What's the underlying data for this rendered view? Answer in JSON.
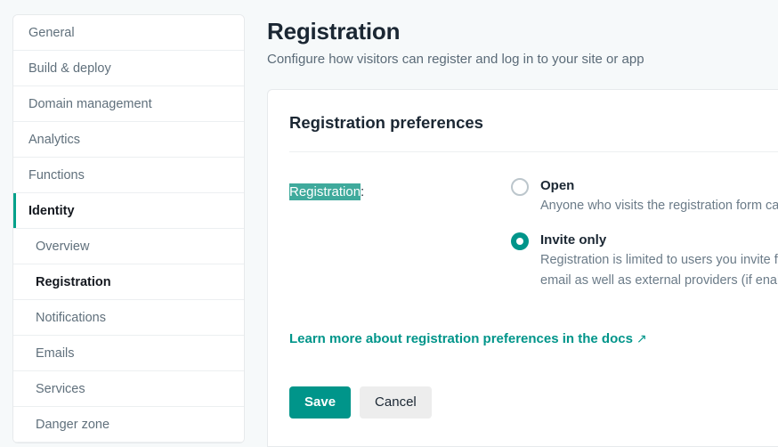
{
  "sidebar": {
    "items": [
      {
        "label": "General",
        "level": "top",
        "active": false
      },
      {
        "label": "Build & deploy",
        "level": "top",
        "active": false
      },
      {
        "label": "Domain management",
        "level": "top",
        "active": false
      },
      {
        "label": "Analytics",
        "level": "top",
        "active": false
      },
      {
        "label": "Functions",
        "level": "top",
        "active": false
      },
      {
        "label": "Identity",
        "level": "top",
        "active": true
      },
      {
        "label": "Overview",
        "level": "sub",
        "active": false
      },
      {
        "label": "Registration",
        "level": "sub",
        "active": true
      },
      {
        "label": "Notifications",
        "level": "sub",
        "active": false
      },
      {
        "label": "Emails",
        "level": "sub",
        "active": false
      },
      {
        "label": "Services",
        "level": "sub",
        "active": false
      },
      {
        "label": "Danger zone",
        "level": "sub",
        "active": false
      }
    ]
  },
  "header": {
    "title": "Registration",
    "subtitle": "Configure how visitors can register and log in to your site or app"
  },
  "card": {
    "title": "Registration preferences",
    "field": {
      "label_selected": "Registration",
      "label_suffix": ":"
    },
    "options": [
      {
        "title": "Open",
        "description": "Anyone who visits the registration form can c",
        "selected": false
      },
      {
        "title": "Invite only",
        "description_line1": "Registration is limited to users you invite from",
        "description_line2": "email as well as external providers (if enabled",
        "selected": true
      }
    ],
    "docs_link": {
      "text": "Learn more about registration preferences in the docs",
      "external_icon": "↗"
    },
    "buttons": {
      "save": "Save",
      "cancel": "Cancel"
    }
  },
  "colors": {
    "accent": "#00958a",
    "selection": "#3faa9c",
    "page_bg": "#f6f9fa"
  }
}
